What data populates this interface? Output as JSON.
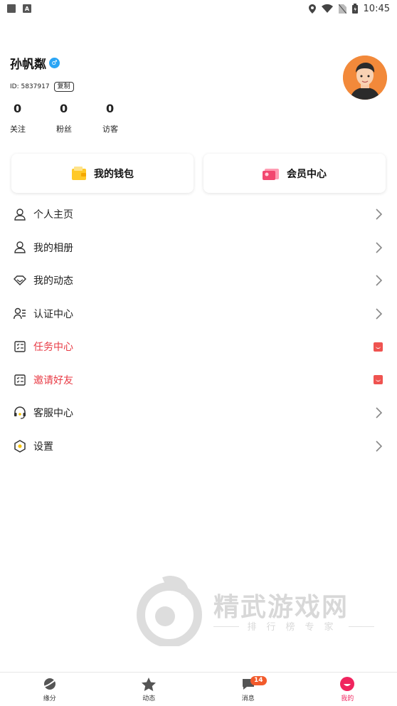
{
  "status_bar": {
    "time": "10:45",
    "left_icon_letter": "A"
  },
  "profile": {
    "username": "孙帆粼",
    "id_text": "ID: 5837917",
    "copy_label": "复制",
    "stats": [
      {
        "value": "0",
        "label": "关注"
      },
      {
        "value": "0",
        "label": "粉丝"
      },
      {
        "value": "0",
        "label": "访客"
      }
    ]
  },
  "cards": {
    "wallet_label": "我的钱包",
    "vip_label": "会员中心"
  },
  "menu": {
    "items": [
      {
        "label": "个人主页",
        "icon": "person-icon"
      },
      {
        "label": "我的相册",
        "icon": "person-icon"
      },
      {
        "label": "我的动态",
        "icon": "diamond-icon"
      },
      {
        "label": "认证中心",
        "icon": "id-card-icon"
      },
      {
        "label": "任务中心",
        "icon": "task-list-icon",
        "highlight": true
      },
      {
        "label": "邀请好友",
        "icon": "task-list-icon",
        "highlight": true
      },
      {
        "label": "客服中心",
        "icon": "headset-icon"
      },
      {
        "label": "设置",
        "icon": "hexagon-settings-icon"
      }
    ]
  },
  "watermark": {
    "title": "精武游戏网",
    "subtitle": "排行榜专家"
  },
  "bottom_nav": {
    "tabs": [
      {
        "label": "缘分",
        "icon": "planet-icon"
      },
      {
        "label": "动态",
        "icon": "star-icon"
      },
      {
        "label": "消息",
        "icon": "chat-icon",
        "badge": "14"
      },
      {
        "label": "我的",
        "icon": "smile-icon",
        "active": true
      }
    ]
  },
  "colors": {
    "accent": "#f0245e",
    "highlight_text": "#e83a44",
    "badge": "#f25a2b",
    "verified": "#2aa5f5"
  }
}
